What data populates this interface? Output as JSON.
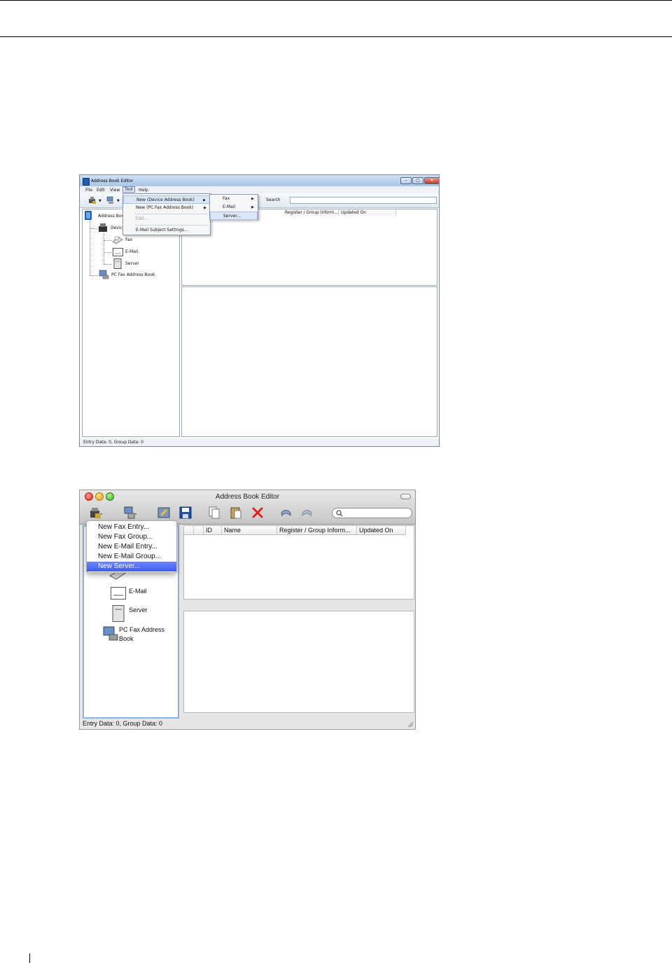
{
  "windows": {
    "title": "Address Book Editor",
    "menubar": [
      "File",
      "Edit",
      "View",
      "Tool",
      "Help"
    ],
    "active_menu": "Tool",
    "toolbar": {
      "search_label": "Search"
    },
    "tree": {
      "root": "Address Book",
      "device_partial": "Devic",
      "fax": "Fax",
      "email": "E-Mail",
      "server": "Server",
      "pc_fax": "PC Fax Address Book"
    },
    "tool_menu": [
      "New (Device Address Book)",
      "New (PC Fax Address Book)",
      "Edit...",
      "E-Mail Subject Settings..."
    ],
    "submenu": [
      "Fax",
      "E-Mail",
      "Server..."
    ],
    "list_columns": [
      "Register / Group Inform...",
      "Updated On"
    ],
    "status": "Entry Data: 0, Group Data: 0"
  },
  "mac": {
    "title": "Address Book Editor",
    "popup_menu": [
      "New Fax Entry...",
      "New Fax Group...",
      "New E-Mail Entry...",
      "New E-Mail Group...",
      "New Server..."
    ],
    "tree": {
      "email": "E-Mail",
      "server": "Server",
      "pc_fax_line1": "PC Fax Address",
      "pc_fax_line2": "Book"
    },
    "list_columns": [
      "ID",
      "Name",
      "Register / Group Inform...",
      "Updated On"
    ],
    "status": "Entry Data: 0, Group Data: 0"
  }
}
